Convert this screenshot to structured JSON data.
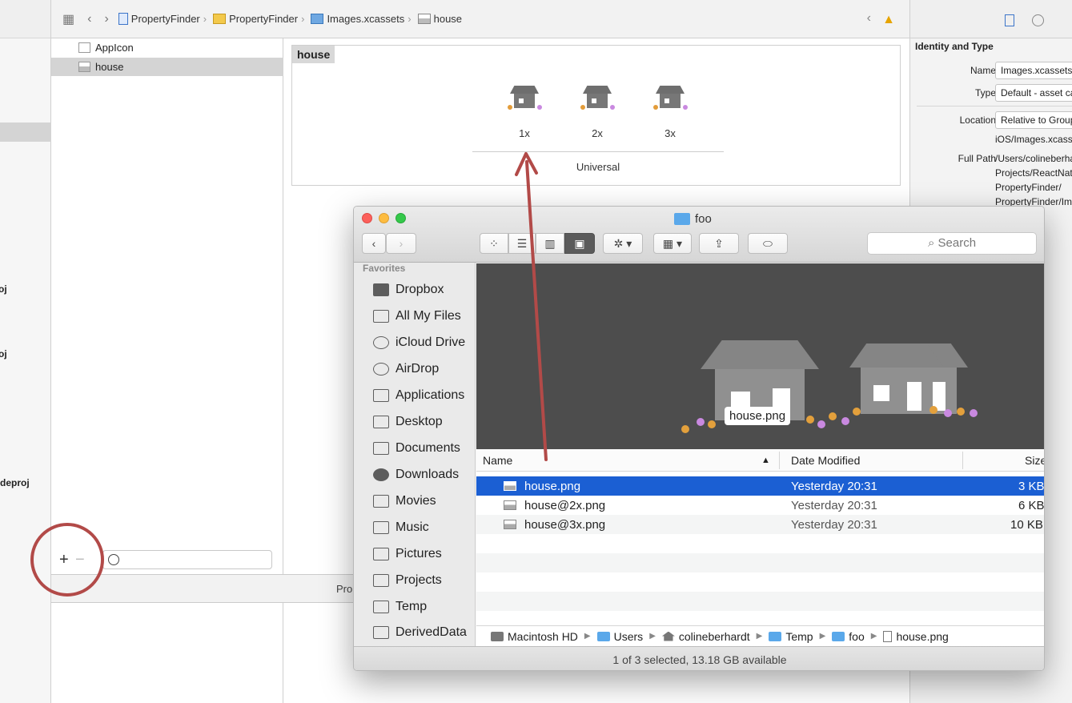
{
  "xcode": {
    "breadcrumbs": [
      "PropertyFinder",
      "PropertyFinder",
      "Images.xcassets",
      "house"
    ],
    "left_fragments": [
      "oj",
      "oj",
      "deproj"
    ],
    "assets": [
      "AppIcon",
      "house"
    ],
    "asset_name": "house",
    "slots": [
      "1x",
      "2x",
      "3x"
    ],
    "universal_label": "Universal",
    "debug_text": "Pro",
    "inspector": {
      "section_title": "Identity and Type",
      "name_label": "Name",
      "name_value": "Images.xcassets",
      "type_label": "Type",
      "type_value": "Default - asset catalog",
      "location_label": "Location",
      "location_value": "Relative to Group",
      "location_sub": "iOS/Images.xcassets",
      "fullpath_label": "Full Path",
      "fullpath_lines": [
        "/Users/colineberhardt/",
        "Projects/ReactNative/",
        "PropertyFinder/",
        "PropertyFinder/Images.xcassets"
      ]
    }
  },
  "finder": {
    "title": "foo",
    "search_placeholder": "Search",
    "sidebar_heading": "Favorites",
    "sidebar_items": [
      "Dropbox",
      "All My Files",
      "iCloud Drive",
      "AirDrop",
      "Applications",
      "Desktop",
      "Documents",
      "Downloads",
      "Movies",
      "Music",
      "Pictures",
      "Projects",
      "Temp",
      "DerivedData"
    ],
    "preview_label": "house.png",
    "columns": {
      "name": "Name",
      "date": "Date Modified",
      "size": "Size"
    },
    "files": [
      {
        "name": "house.png",
        "date": "Yesterday 20:31",
        "size": "3 KB",
        "selected": true
      },
      {
        "name": "house@2x.png",
        "date": "Yesterday 20:31",
        "size": "6 KB",
        "selected": false
      },
      {
        "name": "house@3x.png",
        "date": "Yesterday 20:31",
        "size": "10 KB",
        "selected": false
      }
    ],
    "path": [
      "Macintosh HD",
      "Users",
      "colineberhardt",
      "Temp",
      "foo",
      "house.png"
    ],
    "status": "1 of 3 selected, 13.18 GB available"
  },
  "colors": {
    "annotation": "#b24a48",
    "selection": "#1b5fd3"
  }
}
